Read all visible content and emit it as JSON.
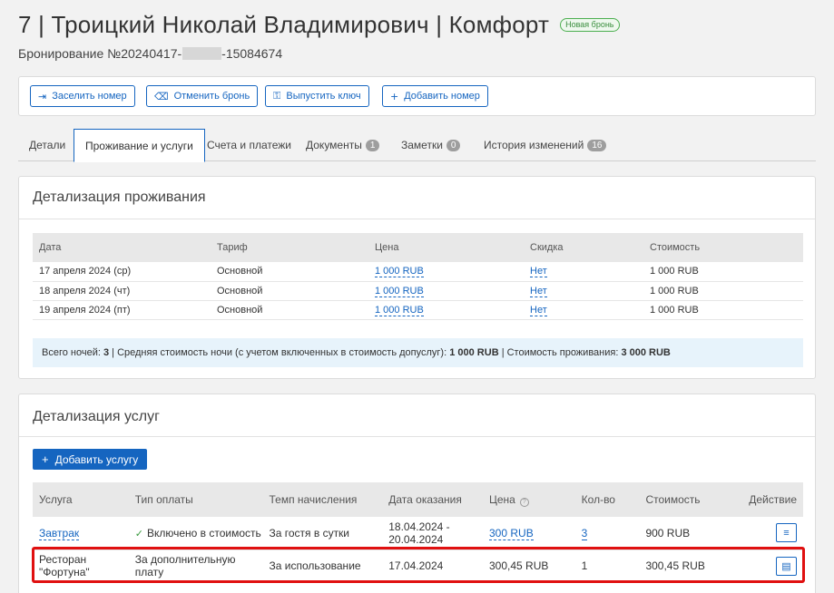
{
  "header": {
    "title": "7 | Троицкий Николай Владимирович | Комфорт",
    "badge": "Новая бронь",
    "booking_prefix": "Бронирование №20240417-",
    "booking_suffix": "-15084674"
  },
  "actions": {
    "checkin": "Заселить номер",
    "cancel": "Отменить бронь",
    "key": "Выпустить ключ",
    "add_room": "Добавить номер"
  },
  "tabs": [
    {
      "label": "Детали"
    },
    {
      "label": "Проживание и услуги"
    },
    {
      "label": "Счета и платежи"
    },
    {
      "label": "Документы",
      "count": "1"
    },
    {
      "label": "Заметки",
      "count": "0"
    },
    {
      "label": "История изменений",
      "count": "16"
    }
  ],
  "stay": {
    "title": "Детализация проживания",
    "headers": [
      "Дата",
      "Тариф",
      "Цена",
      "Скидка",
      "Стоимость"
    ],
    "rows": [
      [
        "17 апреля 2024 (ср)",
        "Основной",
        "1 000 RUB",
        "Нет",
        "1 000 RUB"
      ],
      [
        "18 апреля 2024 (чт)",
        "Основной",
        "1 000 RUB",
        "Нет",
        "1 000 RUB"
      ],
      [
        "19 апреля 2024 (пт)",
        "Основной",
        "1 000 RUB",
        "Нет",
        "1 000 RUB"
      ]
    ],
    "summary": {
      "nights_label": "Всего ночей:",
      "nights": "3",
      "avg_label": "| Средняя стоимость ночи (с учетом включенных в стоимость допуслуг):",
      "avg": "1 000 RUB",
      "total_label": "| Стоимость проживания:",
      "total": "3 000 RUB"
    }
  },
  "services": {
    "title": "Детализация услуг",
    "add_button": "Добавить услугу",
    "headers": [
      "Услуга",
      "Тип оплаты",
      "Темп начисления",
      "Дата оказания",
      "Цена",
      "Кол-во",
      "Стоимость",
      "Действие"
    ],
    "rows": [
      {
        "service": "Завтрак",
        "payment": "Включено в стоимость",
        "rate": "За гостя в сутки",
        "date1": "18.04.2024 -",
        "date2": "20.04.2024",
        "price": "300 RUB",
        "qty": "3",
        "cost": "900 RUB"
      },
      {
        "service1": "Ресторан",
        "service2": "\"Фортуна\"",
        "payment": "За дополнительную плату",
        "rate": "За использование",
        "date": "17.04.2024",
        "price": "300,45 RUB",
        "qty": "1",
        "cost": "300,45 RUB"
      }
    ]
  },
  "colors": {
    "accent": "#1565c0",
    "highlight": "#e01010",
    "success": "#3a9b3f"
  }
}
